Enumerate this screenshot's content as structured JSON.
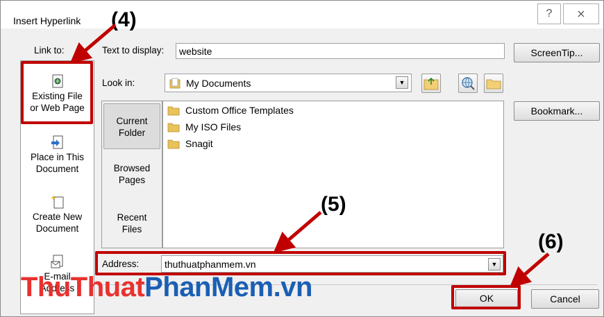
{
  "dialog": {
    "title": "Insert Hyperlink",
    "help_symbol": "?",
    "close_symbol": "⨯"
  },
  "link_to": {
    "label": "Link to:",
    "items": [
      {
        "line1": "Existing File",
        "line2": "or Web Page",
        "icon": "existing-file-icon"
      },
      {
        "line1": "Place in This",
        "line2": "Document",
        "icon": "place-in-document-icon"
      },
      {
        "line1": "Create New",
        "line2": "Document",
        "icon": "create-new-document-icon"
      },
      {
        "line1": "E-mail",
        "line2": "Address",
        "icon": "email-icon"
      }
    ]
  },
  "text_to_display": {
    "label": "Text to display:",
    "value": "website"
  },
  "look_in": {
    "label": "Look in:",
    "value": "My Documents"
  },
  "side_tabs": [
    {
      "line1": "Current",
      "line2": "Folder"
    },
    {
      "line1": "Browsed",
      "line2": "Pages"
    },
    {
      "line1": "Recent",
      "line2": "Files"
    }
  ],
  "files": [
    "Custom Office Templates",
    "My ISO Files",
    "Snagit"
  ],
  "address": {
    "label": "Address:",
    "value": "thuthuatphanmem.vn"
  },
  "buttons": {
    "screentip": "ScreenTip...",
    "bookmark": "Bookmark...",
    "ok": "OK",
    "cancel": "Cancel"
  },
  "steps": {
    "s4": "(4)",
    "s5": "(5)",
    "s6": "(6)"
  },
  "watermark": {
    "part1": "ThuThuat",
    "part2": "PhanMem",
    "part3": ".vn"
  },
  "colors": {
    "annotation_red": "#c00000",
    "watermark_red": "#e8312f",
    "watermark_blue": "#1a5fb4"
  }
}
